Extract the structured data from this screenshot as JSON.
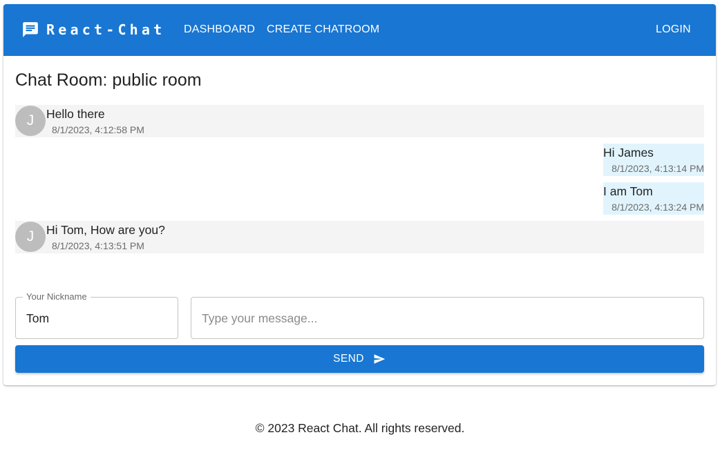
{
  "app": {
    "brand": "React-Chat",
    "accent_color": "#1976d2",
    "brand_icon": "chat-bubble-icon"
  },
  "nav": {
    "dashboard": "DASHBOARD",
    "create_chatroom": "CREATE CHATROOM",
    "login": "LOGIN"
  },
  "room": {
    "title": "Chat Room: public room"
  },
  "messages": [
    {
      "sender_initial": "J",
      "text": "Hello there",
      "time": "8/1/2023, 4:12:58 PM",
      "own": false
    },
    {
      "sender_initial": "",
      "text": "Hi James",
      "time": "8/1/2023, 4:13:14 PM",
      "own": true
    },
    {
      "sender_initial": "",
      "text": "I am Tom",
      "time": "8/1/2023, 4:13:24 PM",
      "own": true
    },
    {
      "sender_initial": "J",
      "text": "Hi Tom, How are you?",
      "time": "8/1/2023, 4:13:51 PM",
      "own": false
    }
  ],
  "composer": {
    "nickname_label": "Your Nickname",
    "nickname_value": "Tom",
    "message_placeholder": "Type your message...",
    "message_value": "",
    "send_label": "SEND",
    "send_icon": "send-icon"
  },
  "footer": {
    "text": "© 2023 React Chat. All rights reserved."
  },
  "colors": {
    "own_message_bg": "#e1f4fd",
    "other_message_bg": "#f4f4f4",
    "avatar_bg": "#bdbdbd"
  }
}
